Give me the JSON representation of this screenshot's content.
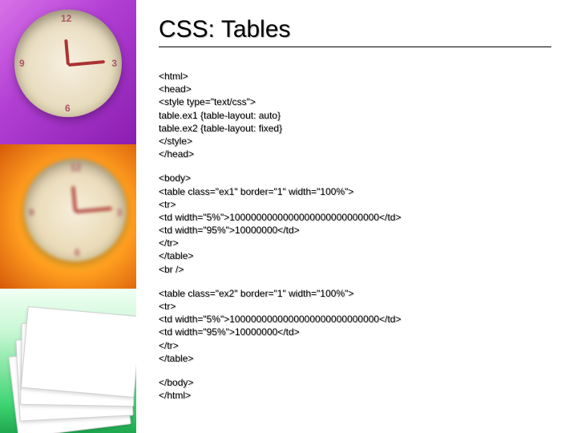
{
  "slide": {
    "title": "CSS: Tables",
    "code_block1": "<html>\n<head>\n<style type=\"text/css\">\ntable.ex1 {table-layout: auto}\ntable.ex2 {table-layout: fixed}\n</style>\n</head>",
    "code_block2": "<body>\n<table class=\"ex1\" border=\"1\" width=\"100%\">\n<tr>\n<td width=\"5%\">1000000000000000000000000000</td>\n<td width=\"95%\">10000000</td>\n</tr>\n</table>\n<br />",
    "code_block3": "<table class=\"ex2\" border=\"1\" width=\"100%\">\n<tr>\n<td width=\"5%\">1000000000000000000000000000</td>\n<td width=\"95%\">10000000</td>\n</tr>\n</table>",
    "code_block4": "</body>\n</html>"
  }
}
